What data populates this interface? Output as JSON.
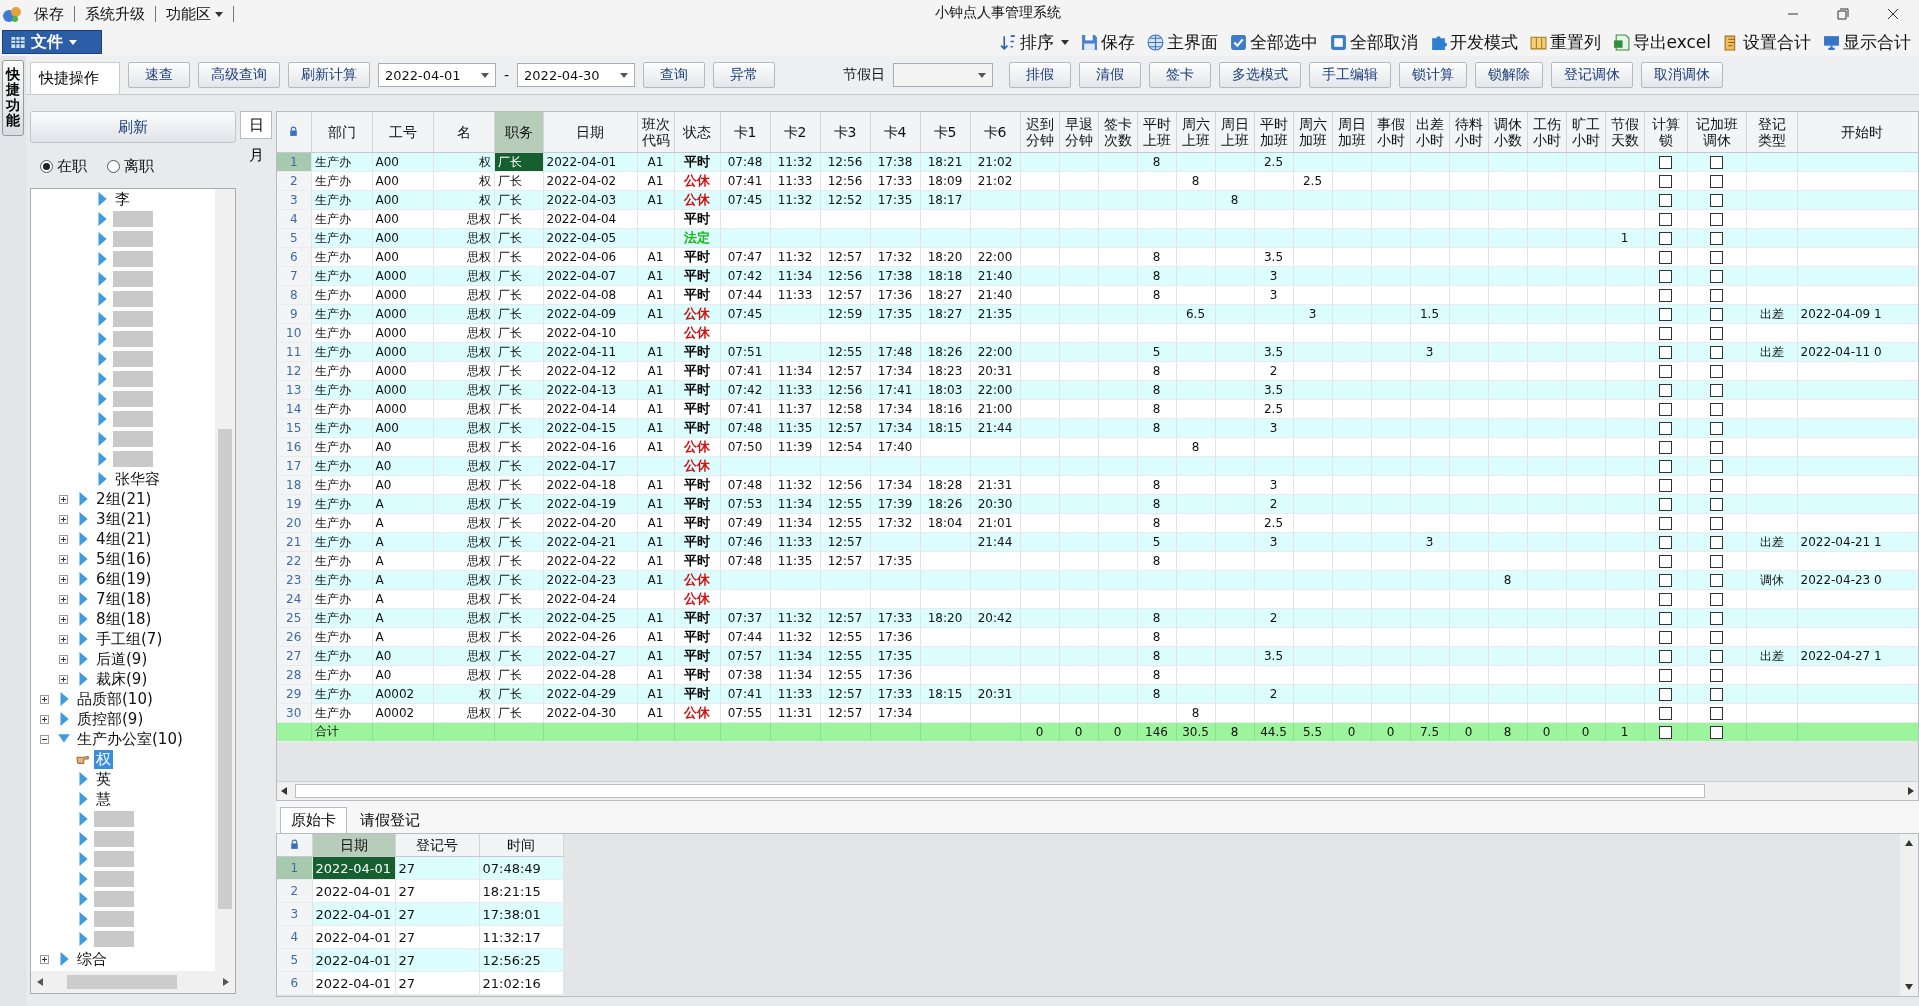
{
  "quick_access": [
    {
      "label": "保存",
      "dropdown": false
    },
    {
      "label": "系统升级",
      "dropdown": false
    },
    {
      "label": "功能区",
      "dropdown": true
    }
  ],
  "title": "小钟点人事管理系统",
  "file_menu": "文件",
  "toolbar": [
    {
      "label": "排序",
      "dropdown": true
    },
    {
      "label": "保存",
      "dropdown": false
    },
    {
      "label": "主界面",
      "dropdown": false
    },
    {
      "label": "全部选中",
      "dropdown": false
    },
    {
      "label": "全部取消",
      "dropdown": false
    },
    {
      "label": "开发模式",
      "dropdown": false
    },
    {
      "label": "重置列",
      "dropdown": false
    },
    {
      "label": "导出excel",
      "dropdown": false
    },
    {
      "label": "设置合计",
      "dropdown": false
    },
    {
      "label": "显示合计",
      "dropdown": false
    }
  ],
  "side_tab": "快捷功能",
  "quick_tab": "快捷操作",
  "actions": [
    {
      "kind": "button",
      "label": "速查"
    },
    {
      "kind": "button",
      "label": "高级查询"
    },
    {
      "kind": "button",
      "label": "刷新计算"
    },
    {
      "kind": "date",
      "value": "2022-04-01"
    },
    {
      "kind": "text",
      "label": "-"
    },
    {
      "kind": "date",
      "value": "2022-04-30"
    },
    {
      "kind": "button",
      "label": "查询"
    },
    {
      "kind": "button",
      "label": "异常"
    },
    {
      "kind": "label",
      "label": "节假日"
    },
    {
      "kind": "select"
    },
    {
      "kind": "button",
      "label": "排假"
    },
    {
      "kind": "button",
      "label": "清假"
    },
    {
      "kind": "button",
      "label": "签卡"
    },
    {
      "kind": "button",
      "label": "多选模式"
    },
    {
      "kind": "button",
      "label": "手工编辑"
    },
    {
      "kind": "button",
      "label": "锁计算"
    },
    {
      "kind": "button",
      "label": "锁解除"
    },
    {
      "kind": "button",
      "label": "登记调休"
    },
    {
      "kind": "button",
      "label": "取消调休"
    }
  ],
  "left": {
    "refresh": "刷新",
    "radios": [
      {
        "label": "在职",
        "selected": true
      },
      {
        "label": "离职",
        "selected": false
      }
    ],
    "tree": [
      {
        "children": [
          {
            "children": [
              {
                "children": [
                  {
                    "label": "李",
                    "selected": false
                  },
                  {
                    "selected": false
                  },
                  {
                    "selected": false
                  },
                  {
                    "selected": false
                  },
                  {
                    "selected": false
                  },
                  {
                    "selected": false
                  },
                  {
                    "selected": false
                  },
                  {
                    "selected": false
                  },
                  {
                    "selected": false
                  },
                  {
                    "selected": false
                  },
                  {
                    "selected": false
                  },
                  {
                    "selected": false
                  },
                  {
                    "selected": false
                  },
                  {
                    "selected": false
                  },
                  {
                    "label": "张华容",
                    "selected": false
                  }
                ]
              },
              {
                "label": "2组(21)",
                "expanded": false,
                "selected": false
              },
              {
                "label": "3组(21)",
                "expanded": false,
                "selected": false
              },
              {
                "label": "4组(21)",
                "expanded": false,
                "selected": false
              },
              {
                "label": "5组(16)",
                "expanded": false,
                "selected": false
              },
              {
                "label": "6组(19)",
                "expanded": false,
                "selected": false
              },
              {
                "label": "7组(18)",
                "expanded": false,
                "selected": false
              },
              {
                "label": "8组(18)",
                "expanded": false,
                "selected": false
              },
              {
                "label": "手工组(7)",
                "expanded": false,
                "selected": false
              },
              {
                "label": "后道(9)",
                "expanded": false,
                "selected": false
              },
              {
                "label": "裁床(9)",
                "expanded": false,
                "selected": false
              }
            ]
          },
          {
            "label": "品质部(10)",
            "expanded": false,
            "selected": false
          },
          {
            "label": "质控部(9)",
            "expanded": false,
            "selected": false
          },
          {
            "label": "生产办公室(10)",
            "expanded": true,
            "selected": false,
            "children": [
              {
                "label": "权",
                "selected": true
              },
              {
                "label": "英",
                "selected": false
              },
              {
                "label": "慧",
                "selected": false
              },
              {
                "selected": false
              },
              {
                "selected": false
              },
              {
                "selected": false
              },
              {
                "selected": false
              },
              {
                "selected": false
              },
              {
                "selected": false
              },
              {
                "selected": false
              }
            ]
          },
          {
            "label": "综合",
            "expanded": false,
            "selected": false
          }
        ]
      }
    ]
  },
  "period_tabs": [
    {
      "label": "日",
      "selected": true
    },
    {
      "label": "月",
      "selected": false
    }
  ],
  "grid": {
    "columns": [
      {
        "kind": "num",
        "selected": false
      },
      {
        "kind": "text",
        "lines": [
          "部门"
        ],
        "selected": false
      },
      {
        "kind": "text",
        "lines": [
          "工号"
        ],
        "selected": false
      },
      {
        "kind": "right",
        "lines": [
          "名"
        ],
        "selected": false
      },
      {
        "kind": "text",
        "lines": [
          "职务"
        ],
        "selected": true
      },
      {
        "kind": "text",
        "lines": [
          "日期"
        ],
        "selected": false
      },
      {
        "kind": "center",
        "lines": [
          "班次",
          "代码"
        ],
        "selected": false
      },
      {
        "kind": "status",
        "lines": [
          "状态"
        ],
        "selected": false
      },
      {
        "kind": "center",
        "lines": [
          "卡1"
        ],
        "selected": false
      },
      {
        "kind": "center",
        "lines": [
          "卡2"
        ],
        "selected": false
      },
      {
        "kind": "center",
        "lines": [
          "卡3"
        ],
        "selected": false
      },
      {
        "kind": "center",
        "lines": [
          "卡4"
        ],
        "selected": false
      },
      {
        "kind": "center",
        "lines": [
          "卡5"
        ],
        "selected": false
      },
      {
        "kind": "center",
        "lines": [
          "卡6"
        ],
        "selected": false
      },
      {
        "kind": "center",
        "lines": [
          "迟到",
          "分钟"
        ],
        "selected": false
      },
      {
        "kind": "center",
        "lines": [
          "早退",
          "分钟"
        ],
        "selected": false
      },
      {
        "kind": "center",
        "lines": [
          "签卡",
          "次数"
        ],
        "selected": false
      },
      {
        "kind": "center",
        "lines": [
          "平时",
          "上班"
        ],
        "selected": false
      },
      {
        "kind": "center",
        "lines": [
          "周六",
          "上班"
        ],
        "selected": false
      },
      {
        "kind": "center",
        "lines": [
          "周日",
          "上班"
        ],
        "selected": false
      },
      {
        "kind": "center",
        "lines": [
          "平时",
          "加班"
        ],
        "selected": false
      },
      {
        "kind": "center",
        "lines": [
          "周六",
          "加班"
        ],
        "selected": false
      },
      {
        "kind": "center",
        "lines": [
          "周日",
          "加班"
        ],
        "selected": false
      },
      {
        "kind": "center",
        "lines": [
          "事假",
          "小时"
        ],
        "selected": false
      },
      {
        "kind": "center",
        "lines": [
          "出差",
          "小时"
        ],
        "selected": false
      },
      {
        "kind": "center",
        "lines": [
          "待料",
          "小时"
        ],
        "selected": false
      },
      {
        "kind": "center",
        "lines": [
          "调休",
          "小数"
        ],
        "selected": false
      },
      {
        "kind": "center",
        "lines": [
          "工伤",
          "小时"
        ],
        "selected": false
      },
      {
        "kind": "center",
        "lines": [
          "旷工",
          "小时"
        ],
        "selected": false
      },
      {
        "kind": "center",
        "lines": [
          "节假",
          "天数"
        ],
        "selected": false
      },
      {
        "kind": "check",
        "lines": [
          "计算",
          "锁"
        ],
        "selected": false
      },
      {
        "kind": "check",
        "lines": [
          "记加班",
          "调休"
        ],
        "selected": false
      },
      {
        "kind": "center",
        "lines": [
          "登记",
          "类型"
        ],
        "selected": false
      },
      {
        "kind": "text",
        "lines": [
          "开始时"
        ],
        "selected": false
      }
    ],
    "rows": [
      {
        "selected": true,
        "color": "#000000",
        "cells": [
          "1",
          "生产办",
          "A00",
          "权",
          "厂长",
          "2022-04-01",
          "A1",
          "平时",
          "07:48",
          "11:32",
          "12:56",
          "17:38",
          "18:21",
          "21:02",
          "",
          "",
          "",
          "8",
          "",
          "",
          "2.5",
          "",
          "",
          "",
          "",
          "",
          "",
          "",
          "",
          "",
          false,
          false,
          "",
          ""
        ]
      },
      {
        "selected": false,
        "color": "#d01010",
        "cells": [
          "2",
          "生产办",
          "A00",
          "权",
          "厂长",
          "2022-04-02",
          "A1",
          "公休",
          "07:41",
          "11:33",
          "12:56",
          "17:33",
          "18:09",
          "21:02",
          "",
          "",
          "",
          "",
          "8",
          "",
          "",
          "2.5",
          "",
          "",
          "",
          "",
          "",
          "",
          "",
          "",
          false,
          false,
          "",
          ""
        ]
      },
      {
        "selected": false,
        "color": "#d01010",
        "cells": [
          "3",
          "生产办",
          "A00",
          "权",
          "厂长",
          "2022-04-03",
          "A1",
          "公休",
          "07:45",
          "11:32",
          "12:52",
          "17:35",
          "18:17",
          "",
          "",
          "",
          "",
          "",
          "",
          "8",
          "",
          "",
          "",
          "",
          "",
          "",
          "",
          "",
          "",
          "",
          false,
          false,
          "",
          ""
        ]
      },
      {
        "selected": false,
        "color": "#000000",
        "cells": [
          "4",
          "生产办",
          "A00",
          "思权",
          "厂长",
          "2022-04-04",
          "",
          "平时",
          "",
          "",
          "",
          "",
          "",
          "",
          "",
          "",
          "",
          "",
          "",
          "",
          "",
          "",
          "",
          "",
          "",
          "",
          "",
          "",
          "",
          "",
          false,
          false,
          "",
          ""
        ]
      },
      {
        "selected": false,
        "color": "#18b818",
        "cells": [
          "5",
          "生产办",
          "A00",
          "思权",
          "厂长",
          "2022-04-05",
          "",
          "法定",
          "",
          "",
          "",
          "",
          "",
          "",
          "",
          "",
          "",
          "",
          "",
          "",
          "",
          "",
          "",
          "",
          "",
          "",
          "",
          "",
          "",
          "1",
          false,
          false,
          "",
          ""
        ]
      },
      {
        "selected": false,
        "color": "#000000",
        "cells": [
          "6",
          "生产办",
          "A00",
          "思权",
          "厂长",
          "2022-04-06",
          "A1",
          "平时",
          "07:47",
          "11:32",
          "12:57",
          "17:32",
          "18:20",
          "22:00",
          "",
          "",
          "",
          "8",
          "",
          "",
          "3.5",
          "",
          "",
          "",
          "",
          "",
          "",
          "",
          "",
          "",
          false,
          false,
          "",
          ""
        ]
      },
      {
        "selected": false,
        "color": "#000000",
        "cells": [
          "7",
          "生产办",
          "A000",
          "思权",
          "厂长",
          "2022-04-07",
          "A1",
          "平时",
          "07:42",
          "11:34",
          "12:56",
          "17:38",
          "18:18",
          "21:40",
          "",
          "",
          "",
          "8",
          "",
          "",
          "3",
          "",
          "",
          "",
          "",
          "",
          "",
          "",
          "",
          "",
          false,
          false,
          "",
          ""
        ]
      },
      {
        "selected": false,
        "color": "#000000",
        "cells": [
          "8",
          "生产办",
          "A000",
          "思权",
          "厂长",
          "2022-04-08",
          "A1",
          "平时",
          "07:44",
          "11:33",
          "12:57",
          "17:36",
          "18:27",
          "21:40",
          "",
          "",
          "",
          "8",
          "",
          "",
          "3",
          "",
          "",
          "",
          "",
          "",
          "",
          "",
          "",
          "",
          false,
          false,
          "",
          ""
        ]
      },
      {
        "selected": false,
        "color": "#d01010",
        "cells": [
          "9",
          "生产办",
          "A000",
          "思权",
          "厂长",
          "2022-04-09",
          "A1",
          "公休",
          "07:45",
          "",
          "12:59",
          "17:35",
          "18:27",
          "21:35",
          "",
          "",
          "",
          "",
          "6.5",
          "",
          "",
          "3",
          "",
          "",
          "1.5",
          "",
          "",
          "",
          "",
          "",
          false,
          false,
          "出差",
          "2022-04-09 1"
        ]
      },
      {
        "selected": false,
        "color": "#d01010",
        "cells": [
          "10",
          "生产办",
          "A000",
          "思权",
          "厂长",
          "2022-04-10",
          "",
          "公休",
          "",
          "",
          "",
          "",
          "",
          "",
          "",
          "",
          "",
          "",
          "",
          "",
          "",
          "",
          "",
          "",
          "",
          "",
          "",
          "",
          "",
          "",
          false,
          false,
          "",
          ""
        ]
      },
      {
        "selected": false,
        "color": "#000000",
        "cells": [
          "11",
          "生产办",
          "A000",
          "思权",
          "厂长",
          "2022-04-11",
          "A1",
          "平时",
          "07:51",
          "",
          "12:55",
          "17:48",
          "18:26",
          "22:00",
          "",
          "",
          "",
          "5",
          "",
          "",
          "3.5",
          "",
          "",
          "",
          "3",
          "",
          "",
          "",
          "",
          "",
          false,
          false,
          "出差",
          "2022-04-11 0"
        ]
      },
      {
        "selected": false,
        "color": "#000000",
        "cells": [
          "12",
          "生产办",
          "A000",
          "思权",
          "厂长",
          "2022-04-12",
          "A1",
          "平时",
          "07:41",
          "11:34",
          "12:57",
          "17:34",
          "18:23",
          "20:31",
          "",
          "",
          "",
          "8",
          "",
          "",
          "2",
          "",
          "",
          "",
          "",
          "",
          "",
          "",
          "",
          "",
          false,
          false,
          "",
          ""
        ]
      },
      {
        "selected": false,
        "color": "#000000",
        "cells": [
          "13",
          "生产办",
          "A000",
          "思权",
          "厂长",
          "2022-04-13",
          "A1",
          "平时",
          "07:42",
          "11:33",
          "12:56",
          "17:41",
          "18:03",
          "22:00",
          "",
          "",
          "",
          "8",
          "",
          "",
          "3.5",
          "",
          "",
          "",
          "",
          "",
          "",
          "",
          "",
          "",
          false,
          false,
          "",
          ""
        ]
      },
      {
        "selected": false,
        "color": "#000000",
        "cells": [
          "14",
          "生产办",
          "A000",
          "思权",
          "厂长",
          "2022-04-14",
          "A1",
          "平时",
          "07:41",
          "11:37",
          "12:58",
          "17:34",
          "18:16",
          "21:00",
          "",
          "",
          "",
          "8",
          "",
          "",
          "2.5",
          "",
          "",
          "",
          "",
          "",
          "",
          "",
          "",
          "",
          false,
          false,
          "",
          ""
        ]
      },
      {
        "selected": false,
        "color": "#000000",
        "cells": [
          "15",
          "生产办",
          "A00",
          "思权",
          "厂长",
          "2022-04-15",
          "A1",
          "平时",
          "07:48",
          "11:35",
          "12:57",
          "17:34",
          "18:15",
          "21:44",
          "",
          "",
          "",
          "8",
          "",
          "",
          "3",
          "",
          "",
          "",
          "",
          "",
          "",
          "",
          "",
          "",
          false,
          false,
          "",
          ""
        ]
      },
      {
        "selected": false,
        "color": "#d01010",
        "cells": [
          "16",
          "生产办",
          "A0",
          "思权",
          "厂长",
          "2022-04-16",
          "A1",
          "公休",
          "07:50",
          "11:39",
          "12:54",
          "17:40",
          "",
          "",
          "",
          "",
          "",
          "",
          "8",
          "",
          "",
          "",
          "",
          "",
          "",
          "",
          "",
          "",
          "",
          "",
          false,
          false,
          "",
          ""
        ]
      },
      {
        "selected": false,
        "color": "#d01010",
        "cells": [
          "17",
          "生产办",
          "A0",
          "思权",
          "厂长",
          "2022-04-17",
          "",
          "公休",
          "",
          "",
          "",
          "",
          "",
          "",
          "",
          "",
          "",
          "",
          "",
          "",
          "",
          "",
          "",
          "",
          "",
          "",
          "",
          "",
          "",
          "",
          false,
          false,
          "",
          ""
        ]
      },
      {
        "selected": false,
        "color": "#000000",
        "cells": [
          "18",
          "生产办",
          "A0",
          "思权",
          "厂长",
          "2022-04-18",
          "A1",
          "平时",
          "07:48",
          "11:32",
          "12:56",
          "17:34",
          "18:28",
          "21:31",
          "",
          "",
          "",
          "8",
          "",
          "",
          "3",
          "",
          "",
          "",
          "",
          "",
          "",
          "",
          "",
          "",
          false,
          false,
          "",
          ""
        ]
      },
      {
        "selected": false,
        "color": "#000000",
        "cells": [
          "19",
          "生产办",
          "A",
          "思权",
          "厂长",
          "2022-04-19",
          "A1",
          "平时",
          "07:53",
          "11:34",
          "12:55",
          "17:39",
          "18:26",
          "20:30",
          "",
          "",
          "",
          "8",
          "",
          "",
          "2",
          "",
          "",
          "",
          "",
          "",
          "",
          "",
          "",
          "",
          false,
          false,
          "",
          ""
        ]
      },
      {
        "selected": false,
        "color": "#000000",
        "cells": [
          "20",
          "生产办",
          "A",
          "思权",
          "厂长",
          "2022-04-20",
          "A1",
          "平时",
          "07:49",
          "11:34",
          "12:55",
          "17:32",
          "18:04",
          "21:01",
          "",
          "",
          "",
          "8",
          "",
          "",
          "2.5",
          "",
          "",
          "",
          "",
          "",
          "",
          "",
          "",
          "",
          false,
          false,
          "",
          ""
        ]
      },
      {
        "selected": false,
        "color": "#000000",
        "cells": [
          "21",
          "生产办",
          "A",
          "思权",
          "厂长",
          "2022-04-21",
          "A1",
          "平时",
          "07:46",
          "11:33",
          "12:57",
          "",
          "",
          "21:44",
          "",
          "",
          "",
          "5",
          "",
          "",
          "3",
          "",
          "",
          "",
          "3",
          "",
          "",
          "",
          "",
          "",
          false,
          false,
          "出差",
          "2022-04-21 1"
        ]
      },
      {
        "selected": false,
        "color": "#000000",
        "cells": [
          "22",
          "生产办",
          "A",
          "思权",
          "厂长",
          "2022-04-22",
          "A1",
          "平时",
          "07:48",
          "11:35",
          "12:57",
          "17:35",
          "",
          "",
          "",
          "",
          "",
          "8",
          "",
          "",
          "",
          "",
          "",
          "",
          "",
          "",
          "",
          "",
          "",
          "",
          false,
          false,
          "",
          ""
        ]
      },
      {
        "selected": false,
        "color": "#d01010",
        "cells": [
          "23",
          "生产办",
          "A",
          "思权",
          "厂长",
          "2022-04-23",
          "A1",
          "公休",
          "",
          "",
          "",
          "",
          "",
          "",
          "",
          "",
          "",
          "",
          "",
          "",
          "",
          "",
          "",
          "",
          "",
          "",
          "8",
          "",
          "",
          "",
          false,
          false,
          "调休",
          "2022-04-23 0"
        ]
      },
      {
        "selected": false,
        "color": "#d01010",
        "cells": [
          "24",
          "生产办",
          "A",
          "思权",
          "厂长",
          "2022-04-24",
          "",
          "公休",
          "",
          "",
          "",
          "",
          "",
          "",
          "",
          "",
          "",
          "",
          "",
          "",
          "",
          "",
          "",
          "",
          "",
          "",
          "",
          "",
          "",
          "",
          false,
          false,
          "",
          ""
        ]
      },
      {
        "selected": false,
        "color": "#000000",
        "cells": [
          "25",
          "生产办",
          "A",
          "思权",
          "厂长",
          "2022-04-25",
          "A1",
          "平时",
          "07:37",
          "11:32",
          "12:57",
          "17:33",
          "18:20",
          "20:42",
          "",
          "",
          "",
          "8",
          "",
          "",
          "2",
          "",
          "",
          "",
          "",
          "",
          "",
          "",
          "",
          "",
          false,
          false,
          "",
          ""
        ]
      },
      {
        "selected": false,
        "color": "#000000",
        "cells": [
          "26",
          "生产办",
          "A",
          "思权",
          "厂长",
          "2022-04-26",
          "A1",
          "平时",
          "07:44",
          "11:32",
          "12:55",
          "17:36",
          "",
          "",
          "",
          "",
          "",
          "8",
          "",
          "",
          "",
          "",
          "",
          "",
          "",
          "",
          "",
          "",
          "",
          "",
          false,
          false,
          "",
          ""
        ]
      },
      {
        "selected": false,
        "color": "#000000",
        "cells": [
          "27",
          "生产办",
          "A0",
          "思权",
          "厂长",
          "2022-04-27",
          "A1",
          "平时",
          "07:57",
          "11:34",
          "12:55",
          "17:35",
          "",
          "",
          "",
          "",
          "",
          "8",
          "",
          "",
          "3.5",
          "",
          "",
          "",
          "",
          "",
          "",
          "",
          "",
          "",
          false,
          false,
          "出差",
          "2022-04-27 1"
        ]
      },
      {
        "selected": false,
        "color": "#000000",
        "cells": [
          "28",
          "生产办",
          "A0",
          "思权",
          "厂长",
          "2022-04-28",
          "A1",
          "平时",
          "07:38",
          "11:34",
          "12:55",
          "17:36",
          "",
          "",
          "",
          "",
          "",
          "8",
          "",
          "",
          "",
          "",
          "",
          "",
          "",
          "",
          "",
          "",
          "",
          "",
          false,
          false,
          "",
          ""
        ]
      },
      {
        "selected": false,
        "color": "#000000",
        "cells": [
          "29",
          "生产办",
          "A0002",
          "权",
          "厂长",
          "2022-04-29",
          "A1",
          "平时",
          "07:41",
          "11:33",
          "12:57",
          "17:33",
          "18:15",
          "20:31",
          "",
          "",
          "",
          "8",
          "",
          "",
          "2",
          "",
          "",
          "",
          "",
          "",
          "",
          "",
          "",
          "",
          false,
          false,
          "",
          ""
        ]
      },
      {
        "selected": false,
        "color": "#d01010",
        "cells": [
          "30",
          "生产办",
          "A0002",
          "思权",
          "厂长",
          "2022-04-30",
          "A1",
          "公休",
          "07:55",
          "11:31",
          "12:57",
          "17:34",
          "",
          "",
          "",
          "",
          "",
          "",
          "8",
          "",
          "",
          "",
          "",
          "",
          "",
          "",
          "",
          "",
          "",
          "",
          false,
          false,
          "",
          ""
        ]
      }
    ],
    "total": {
      "label": "合计",
      "values": [
        "0",
        "0",
        "0",
        "146",
        "30.5",
        "8",
        "44.5",
        "5.5",
        "0",
        "0",
        "7.5",
        "0",
        "8",
        "0",
        "0",
        "1"
      ],
      "checks": [
        false,
        false
      ]
    }
  },
  "detail": {
    "tabs": [
      {
        "label": "原始卡",
        "selected": true
      },
      {
        "label": "请假登记",
        "selected": false
      }
    ],
    "columns": [
      {
        "kind": "num",
        "selected": false
      },
      {
        "kind": "text",
        "label": "日期",
        "selected": true
      },
      {
        "kind": "text",
        "label": "登记号",
        "selected": false
      },
      {
        "kind": "text",
        "label": "时间",
        "selected": false
      }
    ],
    "rows": [
      {
        "selected": true,
        "cells": [
          "1",
          "2022-04-01",
          "27",
          "07:48:49"
        ]
      },
      {
        "selected": false,
        "cells": [
          "2",
          "2022-04-01",
          "27",
          "18:21:15"
        ]
      },
      {
        "selected": false,
        "cells": [
          "3",
          "2022-04-01",
          "27",
          "17:38:01"
        ]
      },
      {
        "selected": false,
        "cells": [
          "4",
          "2022-04-01",
          "27",
          "11:32:17"
        ]
      },
      {
        "selected": false,
        "cells": [
          "5",
          "2022-04-01",
          "27",
          "12:56:25"
        ]
      },
      {
        "selected": false,
        "cells": [
          "6",
          "2022-04-01",
          "27",
          "21:02:16"
        ]
      }
    ]
  }
}
